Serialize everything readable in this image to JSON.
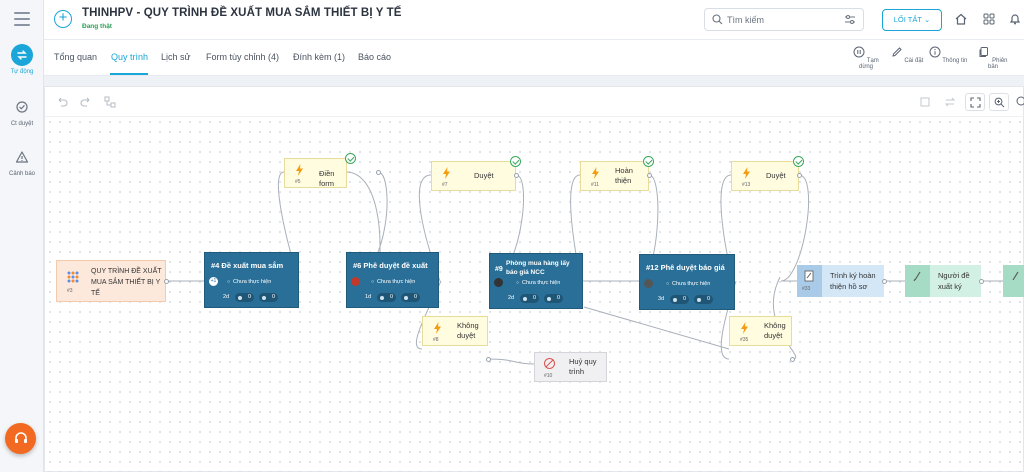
{
  "app": {
    "title": "THINHPV - QUY TRÌNH ĐỀ XUẤT MUA SẮM THIẾT BỊ Y TẾ",
    "status": "Đang thật"
  },
  "sidebar": {
    "items": [
      {
        "label": "Tự động",
        "icon": "auto-icon"
      },
      {
        "label": "Ct duyệt",
        "icon": "check-circle-icon"
      },
      {
        "label": "Cảnh báo",
        "icon": "warning-icon"
      }
    ]
  },
  "header": {
    "search_placeholder": "Tìm kiếm",
    "shortcut_label": "LỐI TẮT"
  },
  "tabs": [
    {
      "label": "Tổng quan"
    },
    {
      "label": "Quy trình"
    },
    {
      "label": "Lịch sử"
    },
    {
      "label": "Form tùy chỉnh (4)"
    },
    {
      "label": "Đính kèm (1)"
    },
    {
      "label": "Báo cáo"
    }
  ],
  "toolbar": [
    {
      "label": "Tạm dừng",
      "icon": "pause-icon"
    },
    {
      "label": "Cài đặt",
      "icon": "pen-icon"
    },
    {
      "label": "Thông tin",
      "icon": "info-icon"
    },
    {
      "label": "Phiên bản",
      "icon": "copy-icon"
    }
  ],
  "nodes": {
    "start": {
      "id": "#3",
      "label": "QUY TRÌNH ĐỀ XUẤT MUA SẮM THIẾT BỊ Y TẾ"
    },
    "t5": {
      "id": "#5",
      "label": "Điền form"
    },
    "t7": {
      "id": "#7",
      "label": "Duyệt"
    },
    "t11": {
      "id": "#11",
      "label": "Hoàn thiện"
    },
    "t13": {
      "id": "#13",
      "label": "Duyệt"
    },
    "t8": {
      "id": "#8",
      "label": "Không duyệt"
    },
    "t35": {
      "id": "#35",
      "label": "Không duyệt"
    },
    "cancel": {
      "id": "#10",
      "label": "Huỷ quy trình"
    },
    "task4": {
      "label": "#4 Đề xuất mua sắm",
      "status": "Chưa thực hiện",
      "duration": "2d",
      "c1": "0",
      "c2": "0",
      "avatar": "+1"
    },
    "task6": {
      "label": "#6 Phê duyệt đề xuất",
      "status": "Chưa thực hiện",
      "duration": "1d",
      "c1": "0",
      "c2": "0"
    },
    "task9": {
      "label": "Phòng mua hàng lấy báo giá NCC",
      "num": "#9",
      "status": "Chưa thực hiện",
      "duration": "2d",
      "c1": "0",
      "c2": "0"
    },
    "task12": {
      "label": "#12 Phê duyệt báo giá",
      "status": "Chưa thực hiện",
      "duration": "3d",
      "c1": "0",
      "c2": "0"
    },
    "sign1": {
      "id": "#33",
      "label": "Trình ký hoàn thiện hồ sơ"
    },
    "sign2": {
      "label": "Người đề xuất ký"
    }
  },
  "colors": {
    "accent": "#1aa6d8",
    "task": "#2a6f97",
    "start": "#fde9dc",
    "trigger": "#fffce0",
    "sign_blue": "#d3e7f7",
    "sign_green": "#d2f0e4",
    "fab": "#f26a21"
  }
}
